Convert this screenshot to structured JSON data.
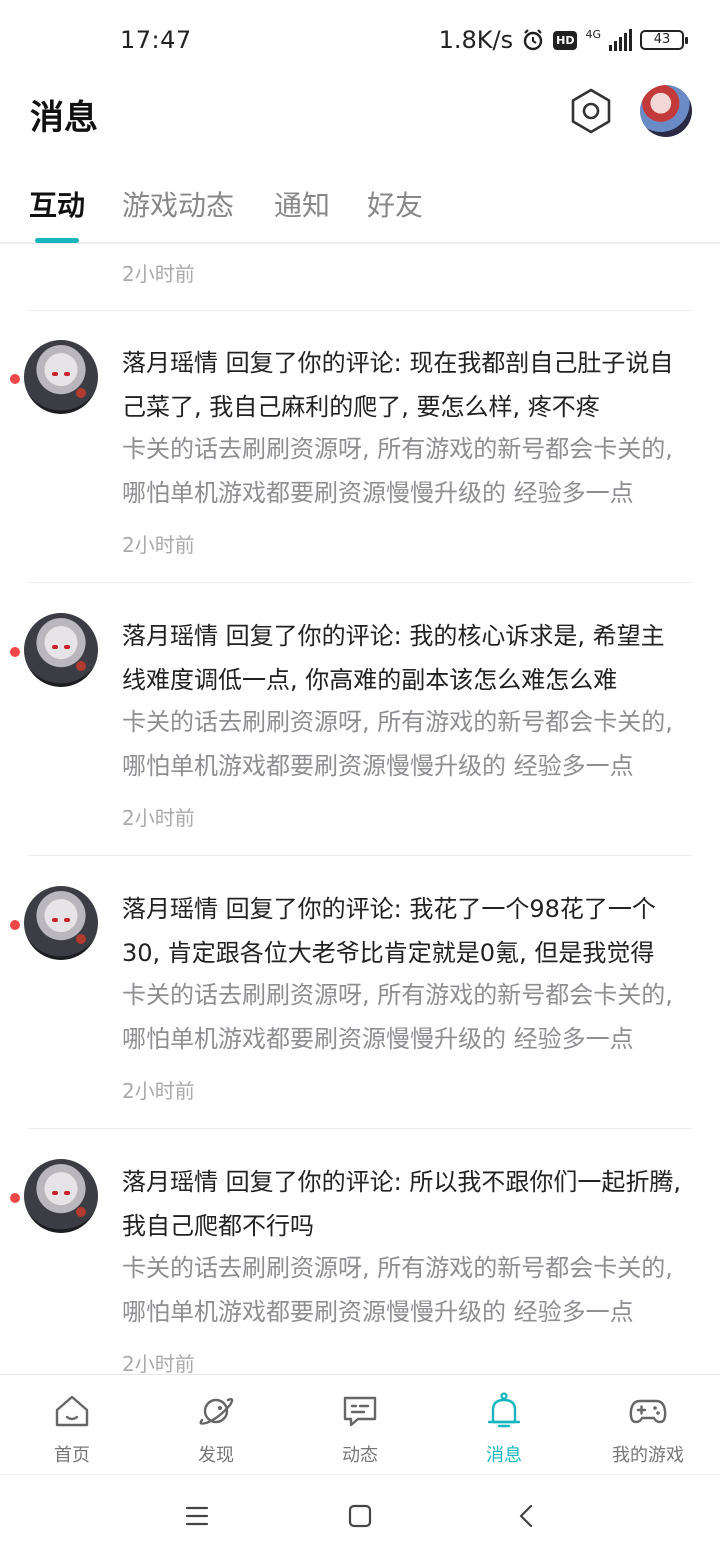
{
  "status_bar": {
    "time": "17:47",
    "net_speed": "1.8K/s",
    "hd": "HD",
    "network": "4G",
    "battery": "43"
  },
  "header": {
    "title": "消息",
    "settings_icon": "settings-hexagon-icon",
    "avatar": "user-avatar"
  },
  "tabs": [
    {
      "label": "互动",
      "active": true
    },
    {
      "label": "游戏动态"
    },
    {
      "label": "通知"
    },
    {
      "label": "好友"
    }
  ],
  "list": {
    "top_time": "2小时前",
    "items": [
      {
        "reply": "落月瑶情 回复了你的评论: 现在我都剖自己肚子说自己菜了, 我自己麻利的爬了, 要怎么样, 疼不疼",
        "quote": "卡关的话去刷刷资源呀, 所有游戏的新号都会卡关的, 哪怕单机游戏都要刷资源慢慢升级的 经验多一点",
        "time": "2小时前"
      },
      {
        "reply": "落月瑶情 回复了你的评论: 我的核心诉求是, 希望主线难度调低一点, 你高难的副本该怎么难怎么难",
        "quote": "卡关的话去刷刷资源呀, 所有游戏的新号都会卡关的, 哪怕单机游戏都要刷资源慢慢升级的 经验多一点",
        "time": "2小时前"
      },
      {
        "reply": "落月瑶情 回复了你的评论: 我花了一个98花了一个30, 肯定跟各位大老爷比肯定就是0氪, 但是我觉得",
        "quote": "卡关的话去刷刷资源呀, 所有游戏的新号都会卡关的, 哪怕单机游戏都要刷资源慢慢升级的 经验多一点",
        "time": "2小时前"
      },
      {
        "reply": "落月瑶情 回复了你的评论: 所以我不跟你们一起折腾, 我自己爬都不行吗",
        "quote": "卡关的话去刷刷资源呀, 所有游戏的新号都会卡关的, 哪怕单机游戏都要刷资源慢慢升级的 经验多一点",
        "time": "2小时前"
      }
    ]
  },
  "bottom_nav": [
    {
      "label": "首页",
      "icon": "home-icon"
    },
    {
      "label": "发现",
      "icon": "planet-icon"
    },
    {
      "label": "动态",
      "icon": "chat-bubble-icon"
    },
    {
      "label": "消息",
      "icon": "bell-icon",
      "active": true
    },
    {
      "label": "我的游戏",
      "icon": "gamepad-icon"
    }
  ],
  "colors": {
    "accent": "#17b6be",
    "unread": "#f04848"
  }
}
